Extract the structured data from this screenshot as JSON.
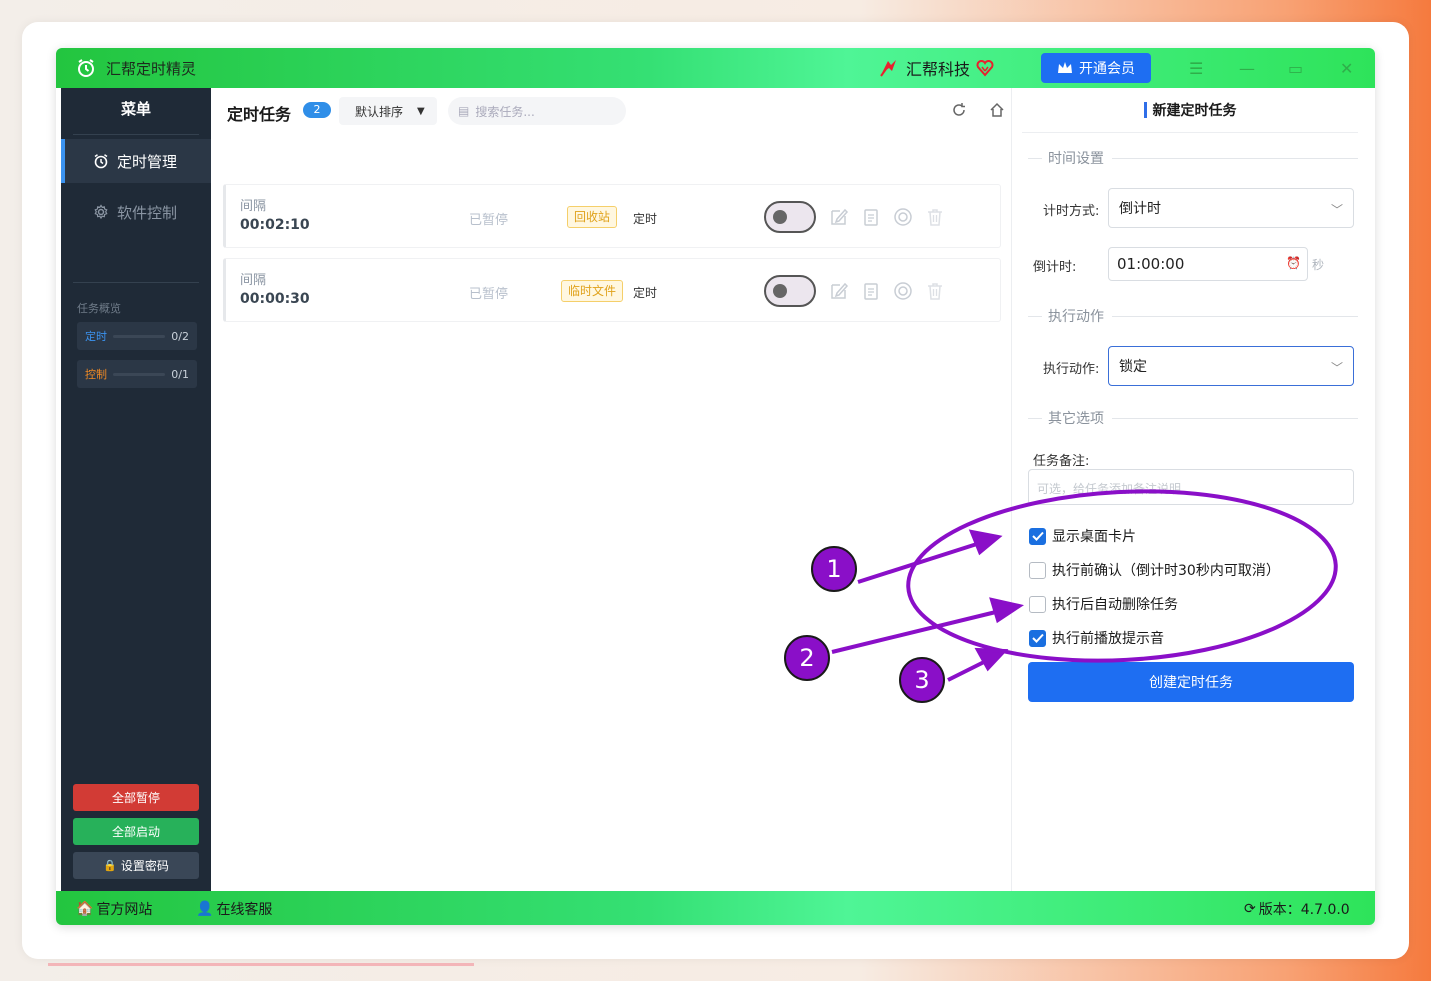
{
  "app": {
    "title": "汇帮定时精灵",
    "brand": "汇帮科技",
    "vip_label": "开通会员"
  },
  "sidebar": {
    "title": "菜单",
    "items": [
      {
        "label": "定时管理",
        "icon": "alarm-clock-icon",
        "active": true
      },
      {
        "label": "软件控制",
        "icon": "gear-icon",
        "active": false
      }
    ],
    "overview_label": "任务概览",
    "stats": [
      {
        "label": "定时",
        "value": "0/2",
        "color": "#3b93f0"
      },
      {
        "label": "控制",
        "value": "0/1",
        "color": "#f08a24"
      }
    ],
    "buttons": {
      "pause_all": "全部暂停",
      "start_all": "全部启动",
      "set_password": "设置密码"
    }
  },
  "main": {
    "title": "定时任务",
    "count": "2",
    "sort_label": "默认排序",
    "search_placeholder": "搜索任务...",
    "tasks": [
      {
        "kind": "间隔",
        "time": "00:02:10",
        "status": "已暂停",
        "tag": "回收站",
        "type": "定时"
      },
      {
        "kind": "间隔",
        "time": "00:00:30",
        "status": "已暂停",
        "tag": "临时文件",
        "type": "定时"
      }
    ]
  },
  "panel": {
    "title": "新建定时任务",
    "time_section": "时间设置",
    "timing_mode_label": "计时方式:",
    "timing_mode_value": "倒计时",
    "countdown_label": "倒计时:",
    "countdown_value": "01:00:00",
    "countdown_unit": "秒",
    "action_section": "执行动作",
    "action_label": "执行动作:",
    "action_value": "锁定",
    "other_section": "其它选项",
    "note_label": "任务备注:",
    "note_placeholder": "可选，给任务添加备注说明...",
    "options": [
      {
        "label": "显示桌面卡片",
        "checked": true
      },
      {
        "label": "执行前确认（倒计时30秒内可取消）",
        "checked": false
      },
      {
        "label": "执行后自动删除任务",
        "checked": false
      },
      {
        "label": "执行前播放提示音",
        "checked": true
      }
    ],
    "create_button": "创建定时任务"
  },
  "footer": {
    "website": "官方网站",
    "support": "在线客服",
    "version": "版本：4.7.0.0"
  },
  "annotations": {
    "labels": [
      "1",
      "2",
      "3"
    ],
    "color": "#8a0fc8"
  }
}
